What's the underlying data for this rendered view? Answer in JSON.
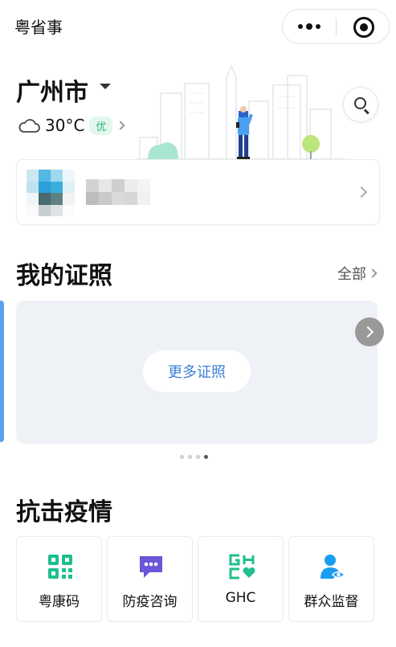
{
  "header": {
    "title": "粤省事",
    "capsule": {
      "more_icon": "more-dots-icon",
      "close_icon": "target-circle-icon"
    }
  },
  "location": {
    "city": "广州市",
    "dropdown_icon": "caret-down-icon"
  },
  "weather": {
    "icon": "cloud-icon",
    "temperature": "30°C",
    "air_quality": "优"
  },
  "search": {
    "icon": "search-icon"
  },
  "user_card": {
    "avatar": "blurred-avatar",
    "name": "blurred-name"
  },
  "certificates": {
    "title": "我的证照",
    "all_label": "全部",
    "more_button": "更多证照",
    "page_count": 4,
    "active_page": 4
  },
  "epidemic": {
    "title": "抗击疫情",
    "tiles": [
      {
        "label": "粤康码",
        "icon": "qr-code-icon"
      },
      {
        "label": "防疫咨询",
        "icon": "chat-bubble-icon"
      },
      {
        "label": "GHC",
        "icon": "ghc-heart-icon"
      },
      {
        "label": "群众监督",
        "icon": "person-eye-icon"
      }
    ]
  },
  "colors": {
    "accent_blue": "#3f7fd6",
    "green": "#1fbf8f",
    "purple": "#6b55d9",
    "sky_blue": "#1a9cf0",
    "card_bg": "#eef1f5"
  }
}
